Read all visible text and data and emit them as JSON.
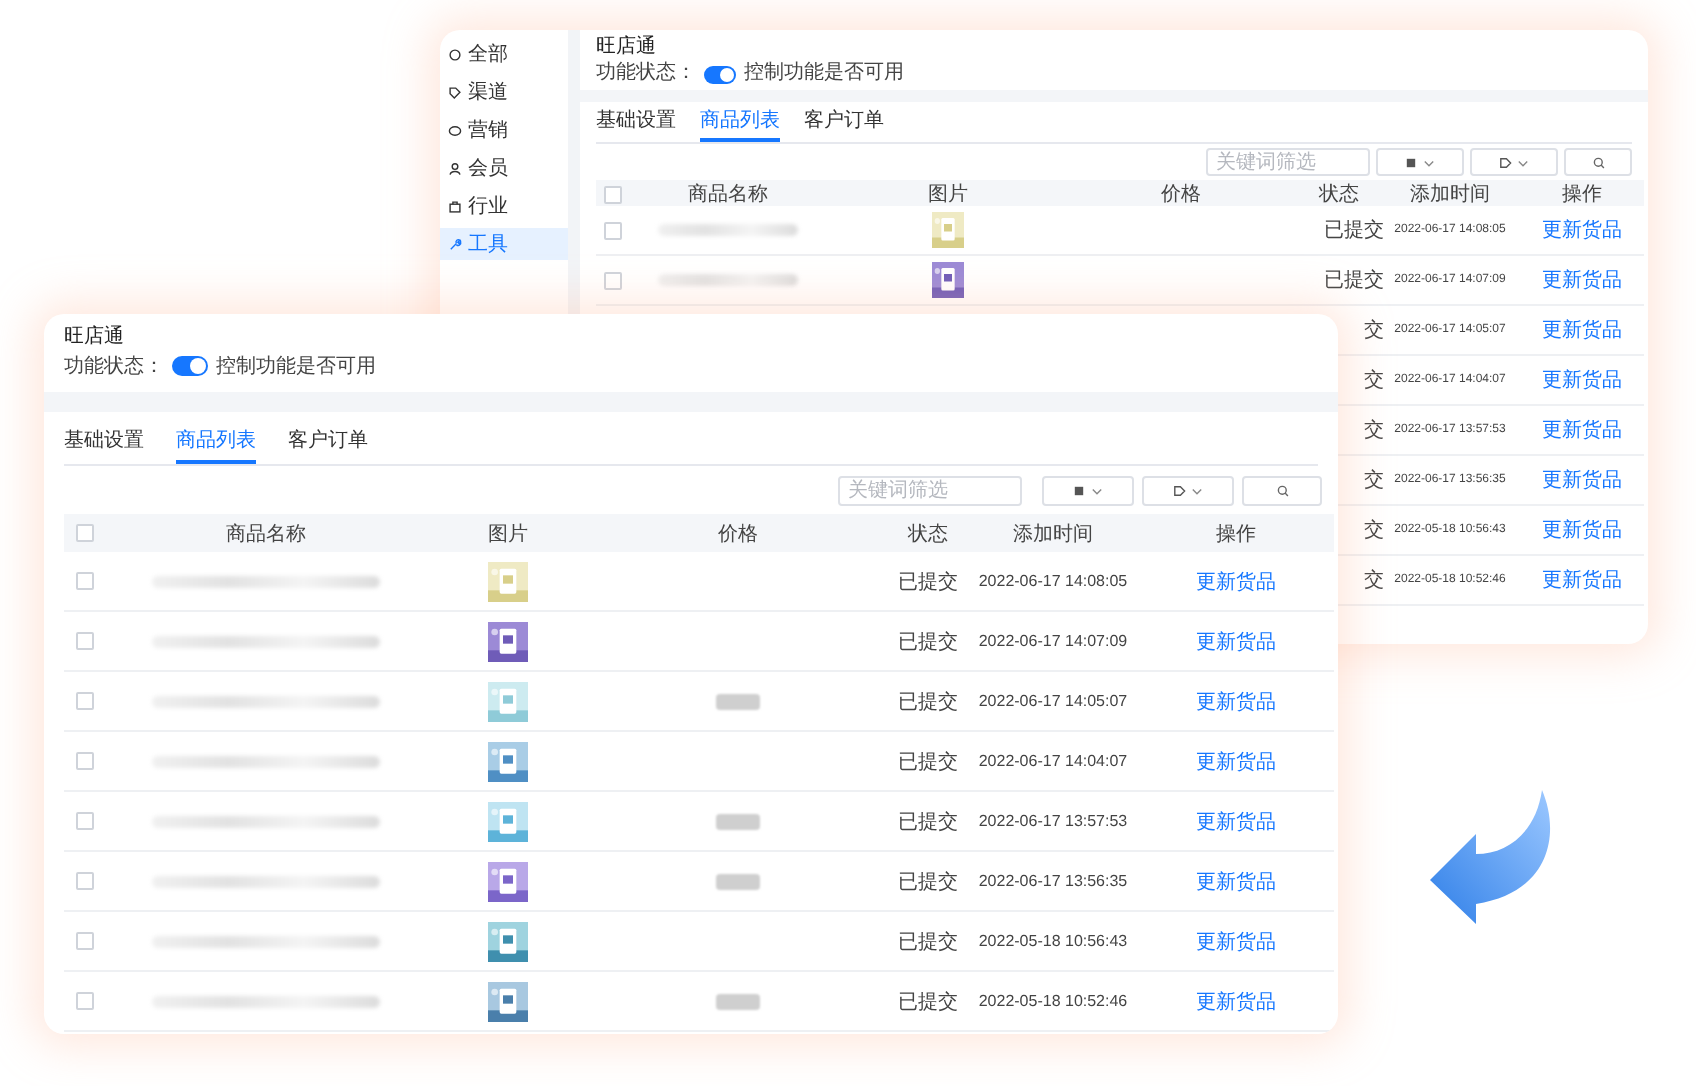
{
  "back_window": {
    "sidebar": {
      "items": [
        {
          "label": "全部",
          "selected": false
        },
        {
          "label": "渠道",
          "selected": false
        },
        {
          "label": "营销",
          "selected": false
        },
        {
          "label": "会员",
          "selected": false
        },
        {
          "label": "行业",
          "selected": false
        },
        {
          "label": "工具",
          "selected": true
        }
      ]
    },
    "title": "旺店通",
    "switch": {
      "label": "功能状态：",
      "on": true,
      "description": "控制功能是否可用"
    },
    "tabs": [
      {
        "label": "基础设置",
        "selected": false
      },
      {
        "label": "商品列表",
        "selected": true
      },
      {
        "label": "客户订单",
        "selected": false
      }
    ],
    "search": {
      "placeholder": "关键词筛选"
    },
    "table": {
      "all_checked": false,
      "columns": [
        "商品名称",
        "图片",
        "价格",
        "状态",
        "添加时间",
        "操作"
      ],
      "rows": [
        {
          "checked": false,
          "price_redacted": false,
          "status": "已提交",
          "added": "2022-06-17 14:08:05",
          "action": "更新货品"
        },
        {
          "checked": false,
          "price_redacted": false,
          "status": "已提交",
          "added": "2022-06-17 14:07:09",
          "action": "更新货品"
        },
        {
          "status": "交",
          "added": "2022-06-17 14:05:07",
          "action": "更新货品"
        },
        {
          "status": "交",
          "added": "2022-06-17 14:04:07",
          "action": "更新货品"
        },
        {
          "status": "交",
          "added": "2022-06-17 13:57:53",
          "action": "更新货品"
        },
        {
          "status": "交",
          "added": "2022-06-17 13:56:35",
          "action": "更新货品"
        },
        {
          "status": "交",
          "added": "2022-05-18 10:56:43",
          "action": "更新货品"
        },
        {
          "status": "交",
          "added": "2022-05-18 10:52:46",
          "action": "更新货品"
        }
      ]
    }
  },
  "front_window": {
    "title": "旺店通",
    "switch": {
      "label": "功能状态：",
      "on": true,
      "description": "控制功能是否可用"
    },
    "tabs": [
      {
        "label": "基础设置",
        "selected": false
      },
      {
        "label": "商品列表",
        "selected": true
      },
      {
        "label": "客户订单",
        "selected": false
      }
    ],
    "search": {
      "placeholder": "关键词筛选"
    },
    "table": {
      "all_checked": false,
      "columns": [
        "商品名称",
        "图片",
        "价格",
        "状态",
        "添加时间",
        "操作"
      ],
      "rows": [
        {
          "checked": false,
          "price_redacted": false,
          "status": "已提交",
          "added": "2022-06-17 14:08:05",
          "action": "更新货品"
        },
        {
          "checked": false,
          "price_redacted": false,
          "status": "已提交",
          "added": "2022-06-17 14:07:09",
          "action": "更新货品"
        },
        {
          "checked": false,
          "price_redacted": true,
          "status": "已提交",
          "added": "2022-06-17 14:05:07",
          "action": "更新货品"
        },
        {
          "checked": false,
          "price_redacted": false,
          "status": "已提交",
          "added": "2022-06-17 14:04:07",
          "action": "更新货品"
        },
        {
          "checked": false,
          "price_redacted": true,
          "status": "已提交",
          "added": "2022-06-17 13:57:53",
          "action": "更新货品"
        },
        {
          "checked": false,
          "price_redacted": true,
          "status": "已提交",
          "added": "2022-06-17 13:56:35",
          "action": "更新货品"
        },
        {
          "checked": false,
          "price_redacted": false,
          "status": "已提交",
          "added": "2022-05-18 10:56:43",
          "action": "更新货品"
        },
        {
          "checked": false,
          "price_redacted": true,
          "status": "已提交",
          "added": "2022-05-18 10:52:46",
          "action": "更新货品"
        }
      ]
    }
  }
}
